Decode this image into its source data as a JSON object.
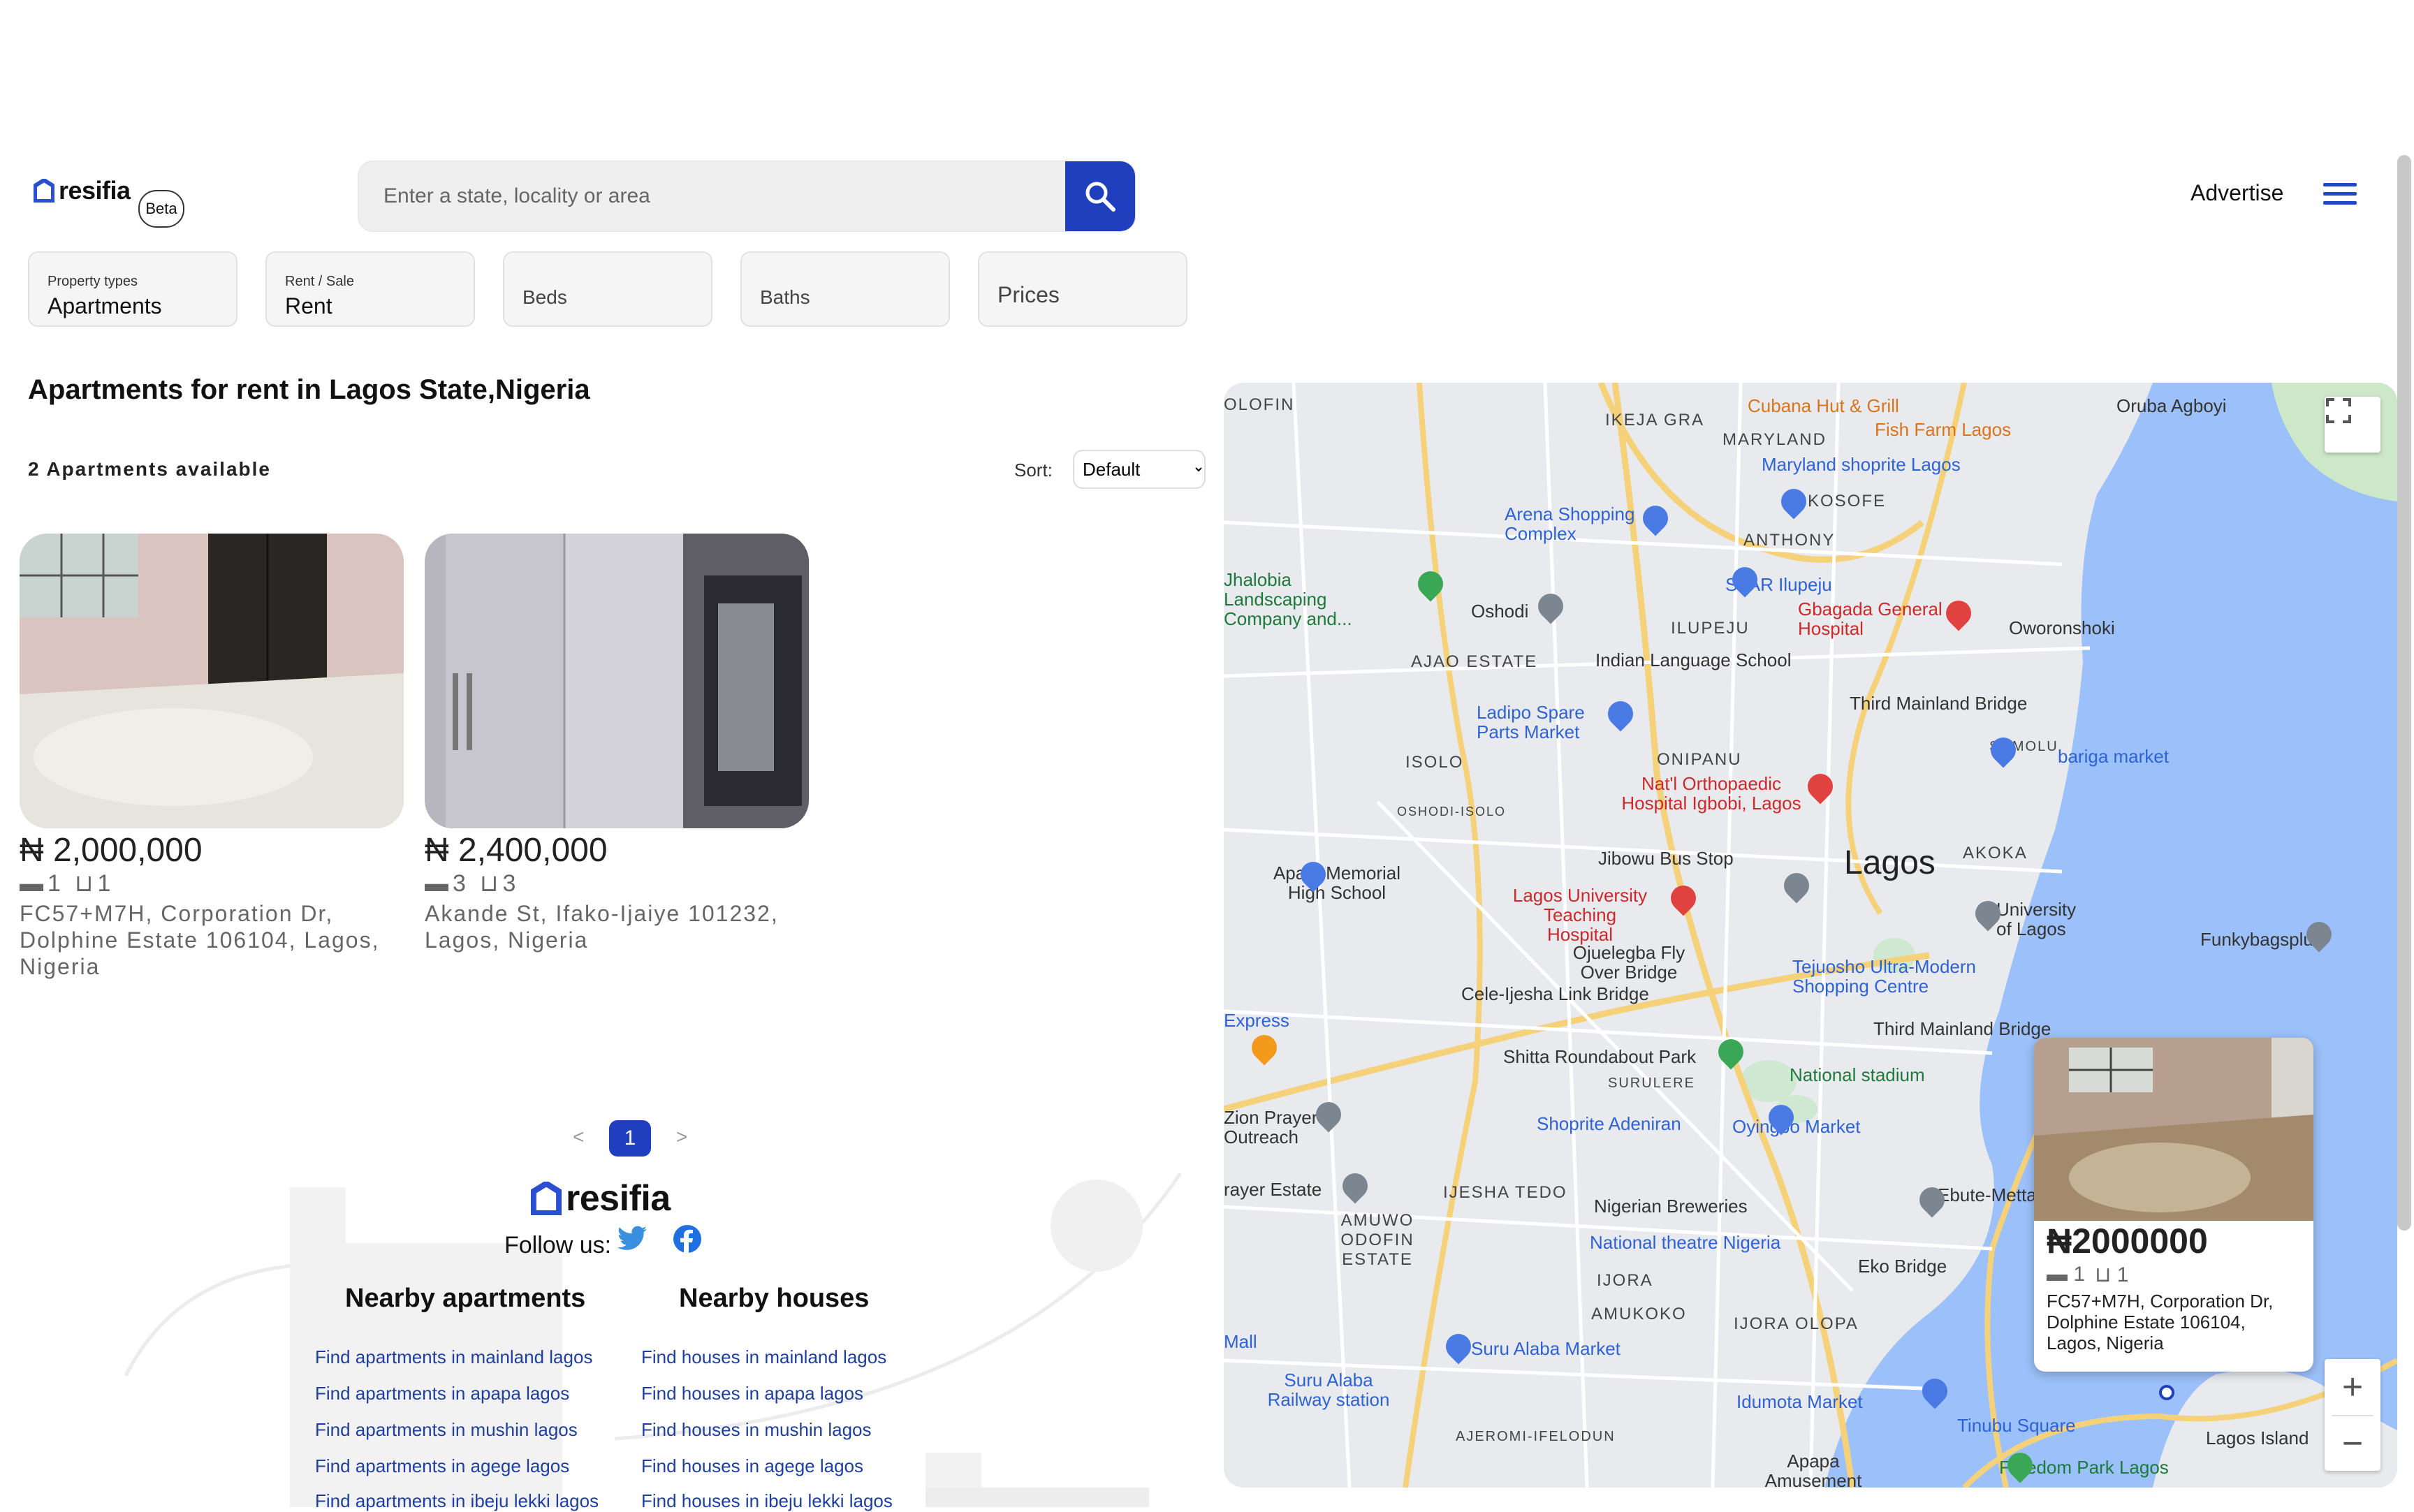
{
  "header": {
    "brand": "resifia",
    "beta_label": "Beta",
    "search_placeholder": "Enter a state, locality or area",
    "advertise_label": "Advertise"
  },
  "filters": {
    "property_types": {
      "label": "Property types",
      "value": "Apartments"
    },
    "rent_sale": {
      "label": "Rent / Sale",
      "value": "Rent"
    },
    "beds": "Beds",
    "baths": "Baths",
    "prices": "Prices"
  },
  "listing": {
    "title": "Apartments for rent in Lagos State,Nigeria",
    "count_text": "2 Apartments available",
    "sort_label": "Sort:",
    "sort_value": "Default",
    "cards": [
      {
        "price": "₦ 2,000,000",
        "beds": "1",
        "baths": "1",
        "address": "FC57+M7H, Corporation Dr, Dolphine Estate 106104, Lagos, Nigeria"
      },
      {
        "price": "₦ 2,400,000",
        "beds": "3",
        "baths": "3",
        "address": "Akande St, Ifako-Ijaiye 101232, Lagos, Nigeria"
      }
    ]
  },
  "pagination": {
    "prev": "<",
    "current": "1",
    "next": ">"
  },
  "footer": {
    "brand": "resifia",
    "follow_label": "Follow us:",
    "nearby_apartments": {
      "heading": "Nearby apartments",
      "links": [
        "Find apartments in mainland lagos",
        "Find apartments in apapa lagos",
        "Find apartments in mushin lagos",
        "Find apartments in agege lagos",
        "Find apartments in ibeju lekki lagos"
      ]
    },
    "nearby_houses": {
      "heading": "Nearby houses",
      "links": [
        "Find houses in mainland lagos",
        "Find houses in apapa lagos",
        "Find houses in mushin lagos",
        "Find houses in agege lagos",
        "Find houses in ibeju lekki lagos"
      ]
    }
  },
  "map": {
    "labels": [
      "OLOFIN",
      "IKEJA GRA",
      "Cubana Hut & Grill",
      "Fish Farm Lagos",
      "Oruba Agboyi",
      "MARYLAND",
      "Maryland shoprite Lagos",
      "KOSOFE",
      "Arena Shopping Complex",
      "ANTHONY",
      "Jhalobia Landscaping Company and...",
      "SPAR Ilupeju",
      "Oshodi",
      "Gbagada General Hospital",
      "Oworonshoki",
      "ILUPEJU",
      "AJAO ESTATE",
      "Indian Language School",
      "Third Mainland Bridge",
      "Ladipo Spare Parts Market",
      "SOMOLU",
      "bariga market",
      "ISOLO",
      "ONIPANU",
      "Nat'l Orthopaedic Hospital Igbobi, Lagos",
      "OSHODI-ISOLO",
      "Jibowu Bus Stop",
      "Lagos",
      "AKOKA",
      "Apata Memorial High School",
      "Lagos University Teaching Hospital",
      "University of Lagos",
      "Funkybagsplus",
      "Ojuelegba Fly Over Bridge",
      "Tejuosho Ultra-Modern Shopping Centre",
      "Cele-Ijesha Link Bridge",
      "Express",
      "Third Mainland Bridge",
      "Shitta Roundabout Park",
      "National stadium",
      "SURULERE",
      "Zion Prayer Outreach",
      "Shoprite Adeniran",
      "Oyingbo Market",
      "rayer Estate",
      "IJESHA TEDO",
      "Ebute-Metta",
      "Nigerian Breweries",
      "AMUWO ODOFIN ESTATE",
      "National theatre Nigeria",
      "Eko Bridge",
      "IJORA",
      "AMUKOKO",
      "IJORA OLOPA",
      "Mall",
      "Suru Alaba Market",
      "Suru Alaba Railway station",
      "Idumota Market",
      "Tinubu Square",
      "AJEROMI-IFELODUN",
      "Apapa Amusement Park",
      "Freedom Park Lagos",
      "Lagos Island"
    ],
    "popup": {
      "price": "₦2000000",
      "beds": "1",
      "baths": "1",
      "address": "FC57+M7H, Corporation Dr, Dolphine Estate 106104, Lagos, Nigeria"
    }
  }
}
